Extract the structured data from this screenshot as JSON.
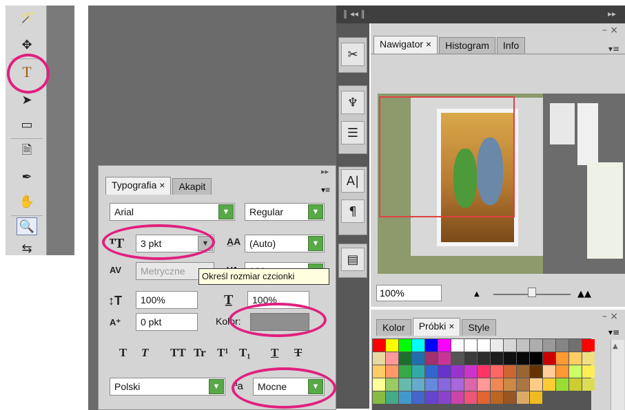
{
  "toolbar": {
    "tools": [
      {
        "name": "magic-wand-icon",
        "glyph": "🪄"
      },
      {
        "name": "move-icon",
        "glyph": "✥"
      },
      {
        "name": "type-tool-icon",
        "glyph": "T"
      },
      {
        "name": "path-selection-icon",
        "glyph": "➤"
      },
      {
        "name": "shape-icon",
        "glyph": "▭"
      },
      {
        "name": "notes-icon",
        "glyph": "🗎"
      },
      {
        "name": "eyedropper-icon",
        "glyph": "✒"
      },
      {
        "name": "hand-icon",
        "glyph": "✋"
      },
      {
        "name": "zoom-icon",
        "glyph": "🔍"
      },
      {
        "name": "swap-colors-icon",
        "glyph": "⇆"
      }
    ]
  },
  "navigator": {
    "tabs": [
      "Nawigator",
      "Histogram",
      "Info"
    ],
    "zoom": "100%"
  },
  "colors_panel": {
    "tabs": [
      "Kolor",
      "Próbki",
      "Style"
    ],
    "swatches": [
      "#ff0000",
      "#ffff00",
      "#00ff00",
      "#00ffff",
      "#0000ff",
      "#ff00ff",
      "#ffffff",
      "#ffffff",
      "#ffffff",
      "#ebebeb",
      "#d6d6d6",
      "#c2c2c2",
      "#adadad",
      "#999999",
      "#858585",
      "#707070",
      "#ff0000",
      "#e8d9a0",
      "#ff9999",
      "#1e6f2e",
      "#1f6fb0",
      "#a03070",
      "#cc3399",
      "#555555",
      "#3c3c3c",
      "#2d2d2d",
      "#1e1e1e",
      "#111111",
      "#080808",
      "#000000",
      "#cc0000",
      "#ff9933",
      "#ffcc66",
      "#f0e080",
      "#ffcc66",
      "#ff9966",
      "#33aa44",
      "#33aaaa",
      "#3366cc",
      "#6633cc",
      "#9933cc",
      "#cc33cc",
      "#ff3366",
      "#ff6666",
      "#cc6633",
      "#996633",
      "#663300",
      "#ffcc99",
      "#ff9933",
      "#ccff66",
      "#ffee55",
      "#ffff99",
      "#99cc66",
      "#66bbaa",
      "#66aacc",
      "#6688dd",
      "#8866dd",
      "#aa66dd",
      "#dd66aa",
      "#ff9999",
      "#ee8855",
      "#cc8844",
      "#aa7744",
      "#ffcc88",
      "#ffcc33",
      "#99dd33",
      "#cccc33",
      "#dddd55",
      "#88bb44",
      "#44aa88",
      "#4499cc",
      "#4466cc",
      "#6644cc",
      "#8844cc",
      "#cc44aa",
      "#ee5577",
      "#dd6633",
      "#bb6622",
      "#995522",
      "#ddaa66",
      "#eebb22"
    ],
    "menu_glyph": "▾≡"
  },
  "typography": {
    "tabs": [
      "Typografia",
      "Akapit"
    ],
    "font_family": "Arial",
    "font_style": "Regular",
    "font_size": "3 pkt",
    "leading": "(Auto)",
    "kerning": "Metryczne",
    "vertical_scale": "100%",
    "horizontal_scale": "100%",
    "baseline_shift": "0 pkt",
    "color_label": "Kolor:",
    "style_buttons": [
      "T",
      "T",
      "TT",
      "Tr",
      "T¹",
      "T₁",
      "T",
      "T"
    ],
    "language": "Polski",
    "antialias_label": "ªa",
    "antialias": "Mocne",
    "tooltip": "Określ rozmiar czcionki",
    "tracking_value": "100"
  }
}
